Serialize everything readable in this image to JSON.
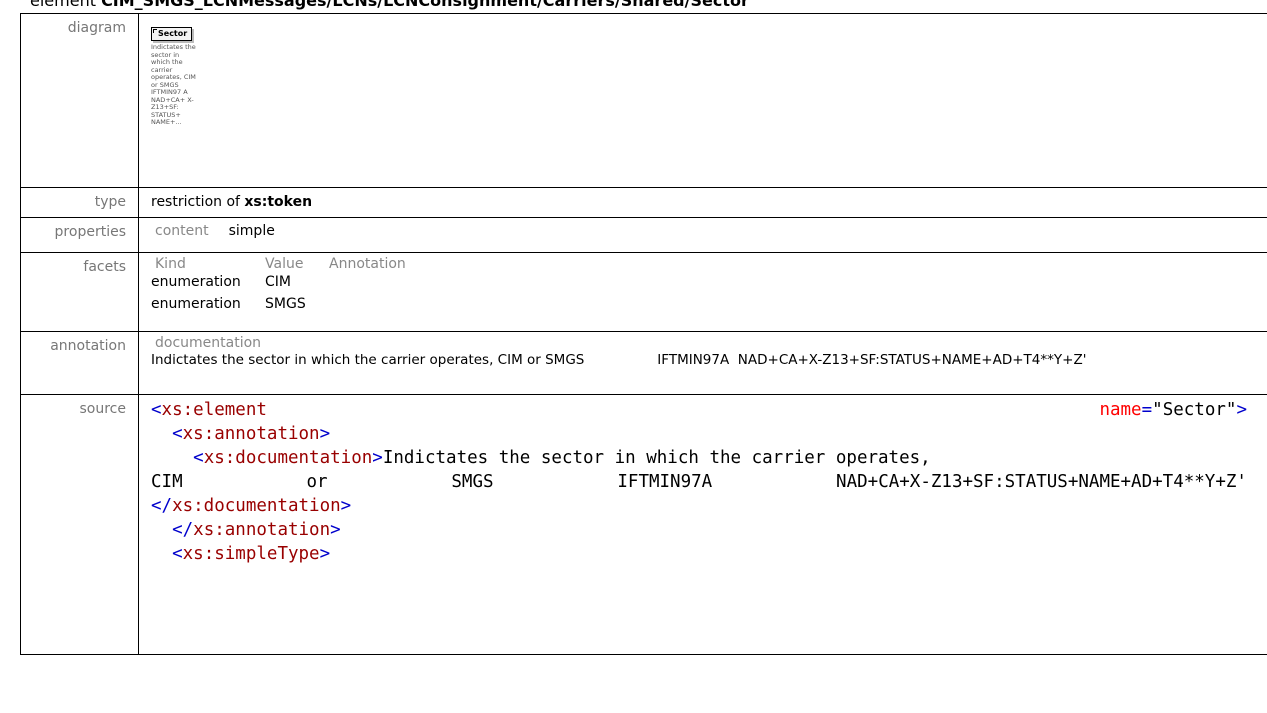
{
  "heading": {
    "prefix": "element ",
    "path": "CIM_SMGS_LCNMessages/LCNs/LCNConsignment/Carriers/Shared/Sector"
  },
  "rows": {
    "diagram": {
      "label": "diagram",
      "box_title": "Sector",
      "box_doc": "Indictates the sector in which the carrier operates, CIM or SMGS IFTMIN97 A NAD+CA+ X-Z13+SF: STATUS+ NAME+..."
    },
    "type": {
      "label": "type",
      "prefix": "restriction of ",
      "type_name": "xs:token"
    },
    "properties": {
      "label": "properties",
      "key": "content",
      "value": "simple"
    },
    "facets": {
      "label": "facets",
      "headers": [
        "Kind",
        "Value",
        "Annotation"
      ],
      "items": [
        {
          "kind": "enumeration",
          "value": "CIM",
          "annotation": ""
        },
        {
          "kind": "enumeration",
          "value": "SMGS",
          "annotation": ""
        }
      ]
    },
    "annotation": {
      "label": "annotation",
      "sub_label": "documentation",
      "text": "Indictates the sector in which the carrier operates, CIM or SMGS                 IFTMIN97A  NAD+CA+X-Z13+SF:STATUS+NAME+AD+T4**Y+Z'"
    },
    "source": {
      "label": "source",
      "line1_tag": "<xs:element",
      "line1_attr": "name",
      "line1_val": "\"Sector\"",
      "line1_end": ">",
      "line2": "<xs:annotation>",
      "line3_open": "<xs:documentation>",
      "line3_text": "Indictates the sector in which the carrier operates,",
      "line4_parts": [
        "CIM",
        "or",
        "SMGS",
        "IFTMIN97A",
        "NAD+CA+X-Z13+SF:STATUS+NAME+AD+T4**Y+Z'"
      ],
      "line5": "</xs:documentation>",
      "line6": "</xs:annotation>",
      "line7": "<xs:simpleType>"
    }
  },
  "colors": {
    "tag": "#990000",
    "bracket": "#0000cc",
    "attr": "#ff0000",
    "label": "#777777"
  }
}
